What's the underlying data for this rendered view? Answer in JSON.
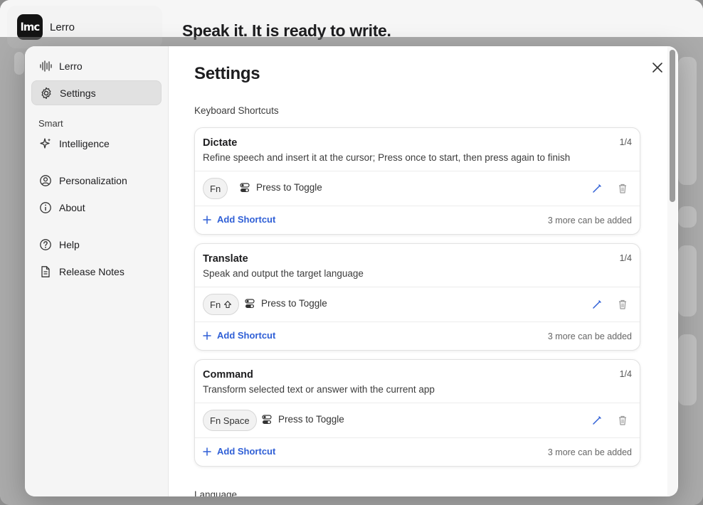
{
  "background": {
    "app_name": "Lerro",
    "logo_text": "lmc",
    "heading": "Speak it. It is ready to write."
  },
  "sidebar": {
    "items": [
      {
        "label": "Lerro",
        "icon": "waveform-icon"
      },
      {
        "label": "Settings",
        "icon": "gear-icon",
        "active": true
      },
      {
        "label": "Intelligence",
        "icon": "sparkle-icon"
      },
      {
        "label": "Personalization",
        "icon": "user-circle-icon"
      },
      {
        "label": "About",
        "icon": "info-icon"
      },
      {
        "label": "Help",
        "icon": "question-icon"
      },
      {
        "label": "Release Notes",
        "icon": "document-icon"
      }
    ],
    "section_smart": "Smart"
  },
  "main": {
    "title": "Settings",
    "section_label": "Keyboard Shortcuts",
    "next_section": "Language",
    "cards": [
      {
        "title": "Dictate",
        "count": "1/4",
        "description": "Refine speech and insert it at the cursor; Press once to start, then press again to finish",
        "key": "Fn",
        "key_icon": "",
        "mode": "Press to Toggle",
        "add_label": "Add Shortcut",
        "more": "3 more can be added"
      },
      {
        "title": "Translate",
        "count": "1/4",
        "description": "Speak and output the target language",
        "key": "Fn",
        "key_icon": "shift-icon",
        "mode": "Press to Toggle",
        "add_label": "Add Shortcut",
        "more": "3 more can be added"
      },
      {
        "title": "Command",
        "count": "1/4",
        "description": "Transform selected text or answer with the current app",
        "key": "Fn Space",
        "key_icon": "",
        "mode": "Press to Toggle",
        "add_label": "Add Shortcut",
        "more": "3 more can be added"
      }
    ]
  },
  "colors": {
    "accent": "#2f5fd6",
    "sidebar_bg": "#f5f5f5",
    "active_item_bg": "#e1e1e1"
  }
}
